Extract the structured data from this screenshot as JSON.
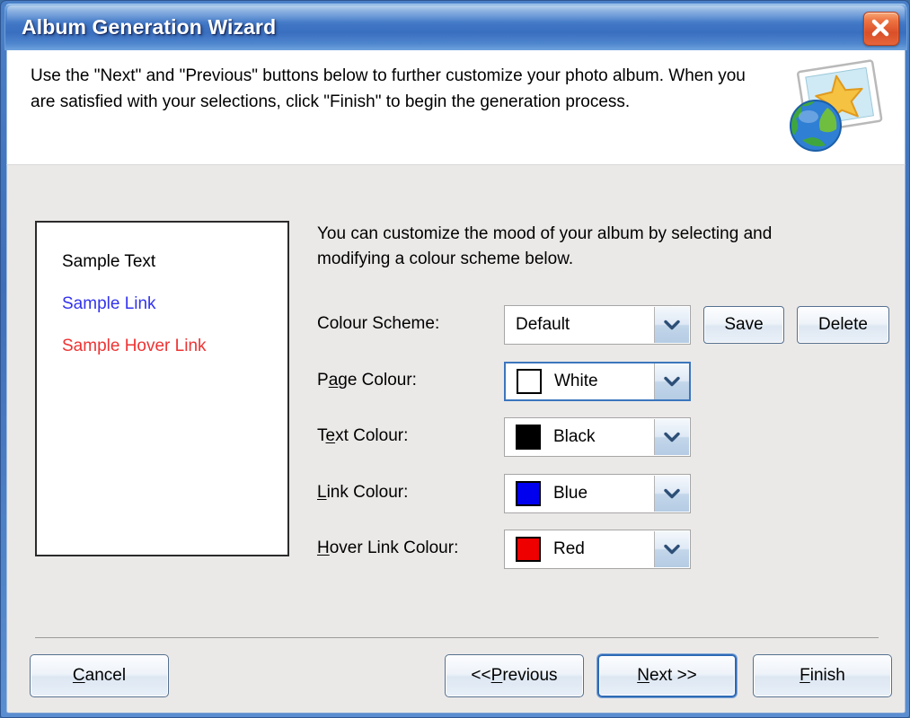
{
  "window": {
    "title": "Album Generation Wizard",
    "close_icon": "close-x-icon"
  },
  "header": {
    "instructions": "Use the \"Next\" and \"Previous\" buttons below to further customize your photo album. When you are satisfied with your selections, click \"Finish\" to begin the generation process.",
    "icon": "photo-star-globe-icon"
  },
  "preview": {
    "background": "#FFFFFF",
    "lines": [
      {
        "label": "Sample Text",
        "color": "#000000"
      },
      {
        "label": "Sample Link",
        "color": "#3333EE"
      },
      {
        "label": "Sample Hover Link",
        "color": "#EE3333"
      }
    ]
  },
  "main": {
    "description": "You can customize the mood of your album by selecting and modifying a colour scheme below.",
    "fields": {
      "scheme": {
        "label": "Colour Scheme:",
        "value": "Default",
        "dropdown_icon": "chevron-down-icon",
        "focused": false
      },
      "page": {
        "label_pre": "P",
        "label_key": "a",
        "label_post": "ge Colour:",
        "value": "White",
        "swatch": "#FFFFFF",
        "dropdown_icon": "chevron-down-icon",
        "focused": true
      },
      "text": {
        "label_pre": "T",
        "label_key": "e",
        "label_post": "xt Colour:",
        "value": "Black",
        "swatch": "#000000",
        "dropdown_icon": "chevron-down-icon",
        "focused": false
      },
      "link": {
        "label_pre": "",
        "label_key": "L",
        "label_post": "ink Colour:",
        "value": "Blue",
        "swatch": "#0000EE",
        "dropdown_icon": "chevron-down-icon",
        "focused": false
      },
      "hover": {
        "label_pre": "",
        "label_key": "H",
        "label_post": "over Link Colour:",
        "value": "Red",
        "swatch": "#EE0000",
        "dropdown_icon": "chevron-down-icon",
        "focused": false
      }
    },
    "save_label": "Save",
    "delete_label": "Delete"
  },
  "footer": {
    "cancel": {
      "pre": "",
      "key": "C",
      "post": "ancel"
    },
    "previous": {
      "pre": "<< ",
      "key": "P",
      "post": "revious"
    },
    "next": {
      "pre": "",
      "key": "N",
      "post": "ext  >>"
    },
    "finish": {
      "pre": "",
      "key": "F",
      "post": "inish"
    }
  }
}
